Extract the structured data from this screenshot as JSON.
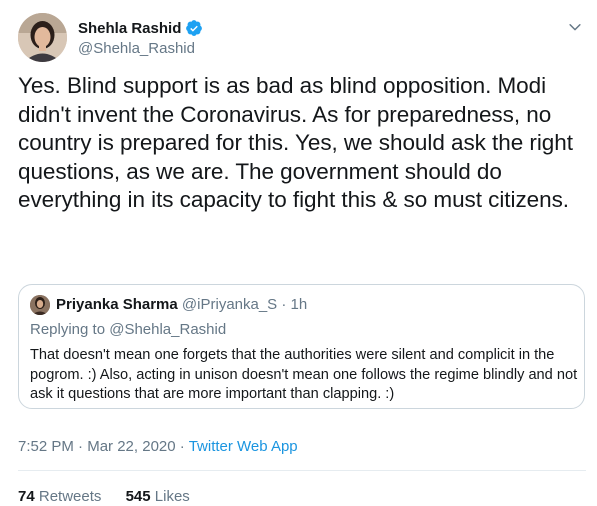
{
  "author": {
    "display_name": "Shehla Rashid",
    "handle": "@Shehla_Rashid",
    "verified_icon": "verified-badge-icon"
  },
  "tweet": {
    "text": "Yes. Blind support is as bad as blind opposition. Modi didn't invent the Coronavirus. As for preparedness, no country is prepared for this. Yes, we should ask the right questions, as we are. The government should do everything in its capacity to fight this & so must citizens."
  },
  "quoted_tweet": {
    "display_name": "Priyanka Sharma",
    "handle": "@iPriyanka_S",
    "separator": "·",
    "time": "1h",
    "replying_prefix": "Replying to",
    "replying_to": "@Shehla_Rashid",
    "text": "That doesn't mean one forgets that the authorities were silent and complicit in the pogrom. :) Also, acting in unison doesn't mean one follows the regime blindly and not ask it questions that are more important than clapping. :)"
  },
  "meta": {
    "time": "7:52 PM",
    "separator1": "·",
    "date": "Mar 22, 2020",
    "separator2": "·",
    "source": "Twitter Web App"
  },
  "stats": {
    "retweets_count": "74",
    "retweets_label": "Retweets",
    "likes_count": "545",
    "likes_label": "Likes"
  },
  "colors": {
    "text": "#14171a",
    "secondary": "#657786",
    "link": "#1b95e0",
    "border": "#ccd6dd",
    "verified": "#1da1f2"
  }
}
